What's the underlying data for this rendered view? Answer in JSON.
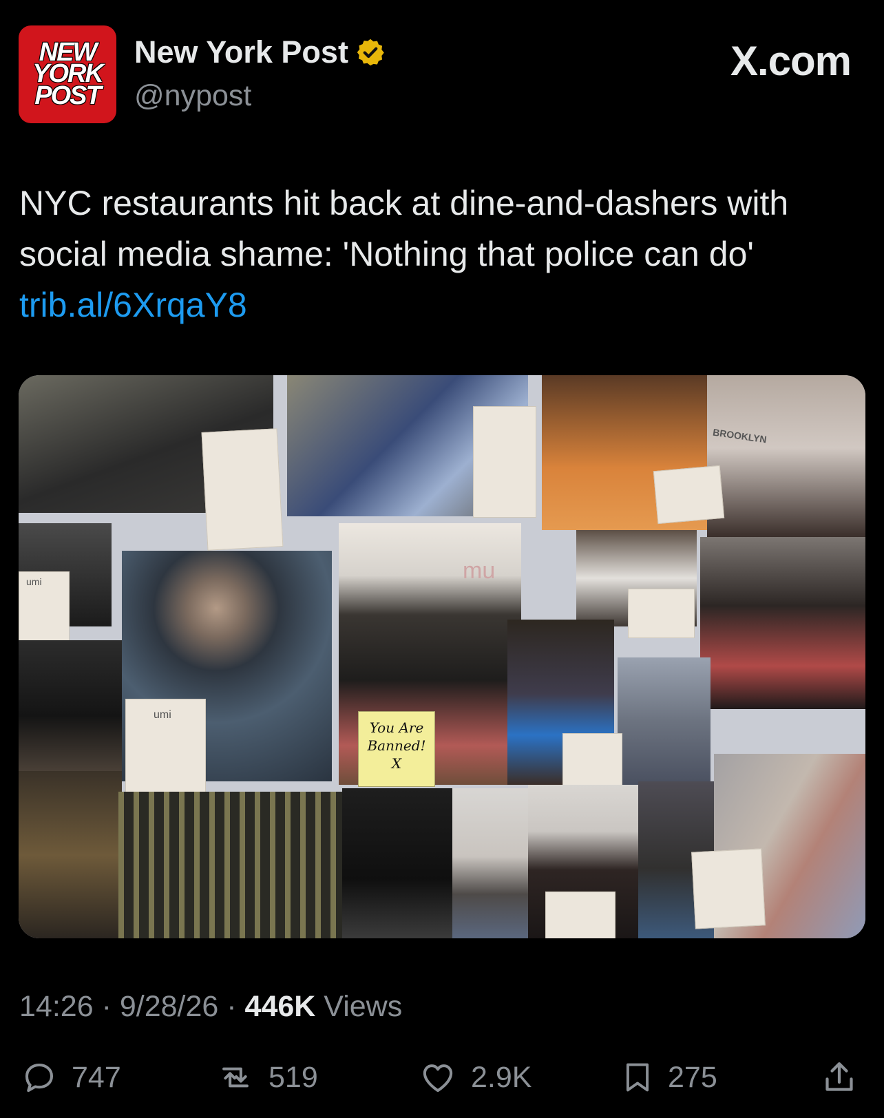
{
  "header": {
    "avatar_lines": [
      "NEW",
      "YORK",
      "POST"
    ],
    "name": "New York Post",
    "handle": "@nypost",
    "verified_icon": "verified-badge-icon",
    "site": "X.com"
  },
  "tweet": {
    "text": "NYC restaurants hit back at dine-and-dashers with social media shame: 'Nothing that police can do'",
    "link": "trib.al/6XrqaY8"
  },
  "media": {
    "sign_lines": [
      "You Are",
      "Banned!",
      "X"
    ],
    "bg_text": {
      "brooklyn": "BROOKLYN",
      "umi": "umi",
      "mu": "mu"
    }
  },
  "meta": {
    "time": "14:26",
    "date": "9/28/26",
    "views_count": "446K",
    "views_label": "Views"
  },
  "actions": {
    "reply": "747",
    "repost": "519",
    "like": "2.9K",
    "bookmark": "275"
  },
  "colors": {
    "background": "#000000",
    "link": "#1d9bf0",
    "verified": "#e8b70a",
    "brand_red": "#d1151c",
    "muted": "#8b9096"
  }
}
